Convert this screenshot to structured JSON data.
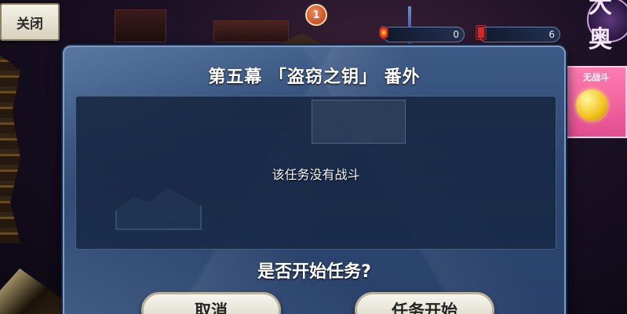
{
  "top_bar": {
    "close_label": "关闭",
    "notification_count": "1",
    "resource_1": {
      "icon": "lantern-icon",
      "value": "0"
    },
    "resource_2": {
      "icon": "card-icon",
      "value": "6"
    },
    "logo_text": "大奥"
  },
  "side_card": {
    "label": "无战斗",
    "icon": "golden-fruit-icon"
  },
  "dialog": {
    "title": "第五幕 「盗窃之钥」 番外",
    "content": "该任务没有战斗",
    "question": "是否开始任务?",
    "cancel_label": "取消",
    "start_label": "任务开始"
  },
  "colors": {
    "dialog_bg": "#2c4670",
    "dialog_border": "#7f9cc4",
    "button_bg": "#f7f5ee",
    "side_card": "#ff7db0"
  }
}
